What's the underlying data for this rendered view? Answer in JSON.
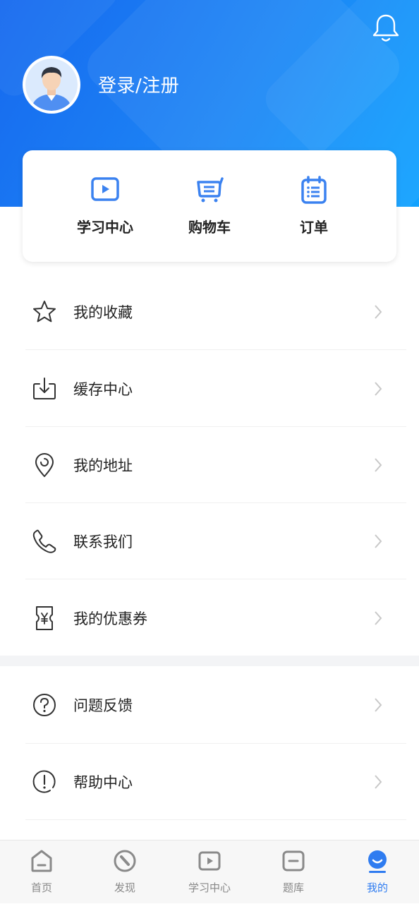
{
  "header": {
    "login_text": "登录/注册",
    "bell_icon": "bell-icon",
    "avatar": "user-avatar"
  },
  "quick": [
    {
      "label": "学习中心",
      "icon": "play-video-icon"
    },
    {
      "label": "购物车",
      "icon": "shopping-cart-icon"
    },
    {
      "label": "订单",
      "icon": "order-list-icon"
    }
  ],
  "menu": [
    {
      "label": "我的收藏",
      "icon": "star-icon"
    },
    {
      "label": "缓存中心",
      "icon": "download-icon"
    },
    {
      "label": "我的地址",
      "icon": "location-pin-icon"
    },
    {
      "label": "联系我们",
      "icon": "phone-icon"
    },
    {
      "label": "我的优惠券",
      "icon": "coupon-icon"
    }
  ],
  "menu2": [
    {
      "label": "问题反馈",
      "icon": "question-icon"
    },
    {
      "label": "帮助中心",
      "icon": "exclamation-icon"
    }
  ],
  "tabs": [
    {
      "label": "首页",
      "icon": "home-icon"
    },
    {
      "label": "发现",
      "icon": "discover-icon"
    },
    {
      "label": "学习中心",
      "icon": "play-video-icon"
    },
    {
      "label": "题库",
      "icon": "question-bank-icon"
    },
    {
      "label": "我的",
      "icon": "profile-icon",
      "active": true
    }
  ],
  "colors": {
    "primary": "#2f7cf0",
    "header_gradient_start": "#1669ef",
    "header_gradient_end": "#11a3ff",
    "icon_blue": "#3b82f0"
  }
}
